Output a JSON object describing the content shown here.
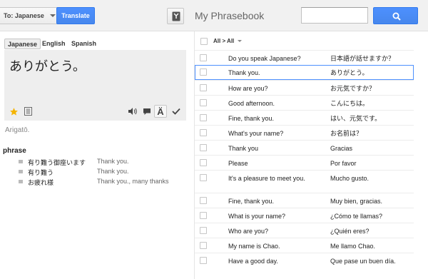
{
  "topbar": {
    "target_language": "To: Japanese",
    "translate_label": "Translate",
    "phrasebook_title": "My Phrasebook",
    "search_value": ""
  },
  "source": {
    "tabs": [
      "Japanese",
      "English",
      "Spanish"
    ],
    "active_tab": "Japanese",
    "result_text": "ありがとう。",
    "transliteration": "Arigatō."
  },
  "dictionary": {
    "part_of_speech": "phrase",
    "entries": [
      {
        "term": "有り難う御座います",
        "translation": "Thank you."
      },
      {
        "term": "有り難う",
        "translation": "Thank you."
      },
      {
        "term": "お疲れ様",
        "translation": "Thank you., many thanks"
      }
    ]
  },
  "phrasebook": {
    "filter_label": "All > All",
    "rows": [
      {
        "src": "Do you speak Japanese?",
        "dst": "日本語が話せますか？"
      },
      {
        "src": "Thank you.",
        "dst": "ありがとう。",
        "selected": true
      },
      {
        "src": "How are you?",
        "dst": "お元気ですか？"
      },
      {
        "src": "Good afternoon.",
        "dst": "こんにちは。"
      },
      {
        "src": "Fine, thank you.",
        "dst": "はい、元気です。"
      },
      {
        "src": "What's your name?",
        "dst": "お名前は？"
      },
      {
        "src": "Thank you",
        "dst": "Gracias"
      },
      {
        "src": "Please",
        "dst": "Por favor"
      },
      {
        "src": "It's a pleasure to meet you.",
        "dst": "Mucho gusto.",
        "tall": true
      },
      {
        "src": "Fine, thank you.",
        "dst": "Muy bien, gracias."
      },
      {
        "src": "What is your name?",
        "dst": "¿Cómo te llamas?"
      },
      {
        "src": "Who are you?",
        "dst": "¿Quién eres?"
      },
      {
        "src": "My name is Chao.",
        "dst": "Me llamo Chao."
      },
      {
        "src": "Have a good day.",
        "dst": "Que pase un buen día."
      }
    ]
  },
  "colors": {
    "accent_blue": "#4d90fe",
    "star_yellow": "#f4b400"
  }
}
